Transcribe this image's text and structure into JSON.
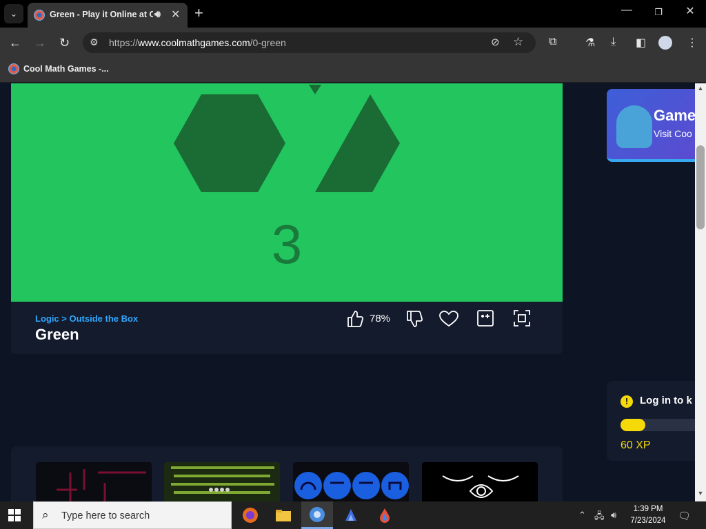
{
  "browser": {
    "tab_title": "Green - Play it Online at Coolmath Games",
    "url_prefix": "https://",
    "url_domain": "www.coolmathgames.com",
    "url_path": "/0-green",
    "bookmark": "Cool Math Games -..."
  },
  "game": {
    "counter": "3",
    "category": "Logic",
    "subcategory": "Outside the Box",
    "breadcrumb_sep": " > ",
    "title": "Green",
    "like_percent": "78%",
    "color": "#22c55e"
  },
  "sidebar": {
    "ad_title": "Game",
    "ad_sub": "Visit Coo",
    "login_text": "Log in to k",
    "xp_value": "60 XP",
    "xp_progress": 0.33
  },
  "taskbar": {
    "search_placeholder": "Type here to search",
    "time": "1:39 PM",
    "date": "7/23/2024"
  }
}
